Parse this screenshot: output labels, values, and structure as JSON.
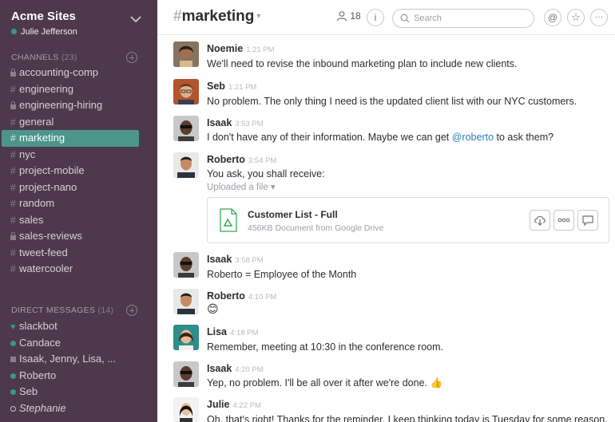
{
  "team": {
    "name": "Acme Sites",
    "user": "Julie Jefferson"
  },
  "channels_section": {
    "title": "CHANNELS",
    "count": "(23)"
  },
  "channels": [
    {
      "name": "accounting-comp",
      "private": true
    },
    {
      "name": "engineering",
      "private": false
    },
    {
      "name": "engineering-hiring",
      "private": true
    },
    {
      "name": "general",
      "private": false
    },
    {
      "name": "marketing",
      "private": false,
      "active": true
    },
    {
      "name": "nyc",
      "private": false
    },
    {
      "name": "project-mobile",
      "private": false
    },
    {
      "name": "project-nano",
      "private": false
    },
    {
      "name": "random",
      "private": false
    },
    {
      "name": "sales",
      "private": false
    },
    {
      "name": "sales-reviews",
      "private": true
    },
    {
      "name": "tweet-feed",
      "private": false
    },
    {
      "name": "watercooler",
      "private": false
    }
  ],
  "dm_section": {
    "title": "DIRECT MESSAGES",
    "count": "(14)"
  },
  "dms": [
    {
      "name": "slackbot",
      "status": "heart"
    },
    {
      "name": "Candace",
      "status": "online"
    },
    {
      "name": "Isaak, Jenny, Lisa, ...",
      "status": "group"
    },
    {
      "name": "Roberto",
      "status": "online"
    },
    {
      "name": "Seb",
      "status": "online"
    },
    {
      "name": "Stephanie",
      "status": "away"
    }
  ],
  "header": {
    "channel": "marketing",
    "hash": "#",
    "member_count": "18",
    "search_placeholder": "Search",
    "info_glyph": "i",
    "mention_glyph": "@",
    "star_glyph": "☆",
    "more_glyph": "···"
  },
  "messages": [
    {
      "author": "Noemie",
      "time": "1:21 PM",
      "text": "We'll need to revise the inbound marketing plan to include new clients."
    },
    {
      "author": "Seb",
      "time": "1:21 PM",
      "text": "No problem. The only thing I need is the updated client list with our NYC customers."
    },
    {
      "author": "Isaak",
      "time": "3:53 PM",
      "text_before": "I don't have any of their information. Maybe we can get ",
      "mention": "@roberto",
      "text_after": " to ask them?"
    },
    {
      "author": "Roberto",
      "time": "3:54 PM",
      "text": "You ask, you shall receive:",
      "uploaded": "Uploaded a file ▾",
      "file": {
        "name": "Customer List - Full",
        "meta": "456KB Document from Google Drive"
      }
    },
    {
      "author": "Isaak",
      "time": "3:58 PM",
      "text": "Roberto = Employee of the Month"
    },
    {
      "author": "Roberto",
      "time": "4:10 PM",
      "text": "😊"
    },
    {
      "author": "Lisa",
      "time": "4:18 PM",
      "text": "Remember, meeting at 10:30 in the conference room."
    },
    {
      "author": "Isaak",
      "time": "4:20 PM",
      "text": "Yep, no problem. I'll be all over it after we're done. 👍"
    },
    {
      "author": "Julie",
      "time": "4:22 PM",
      "text": "Oh, that's right! Thanks for the reminder. I keep thinking today is Tuesday for some reason."
    }
  ]
}
